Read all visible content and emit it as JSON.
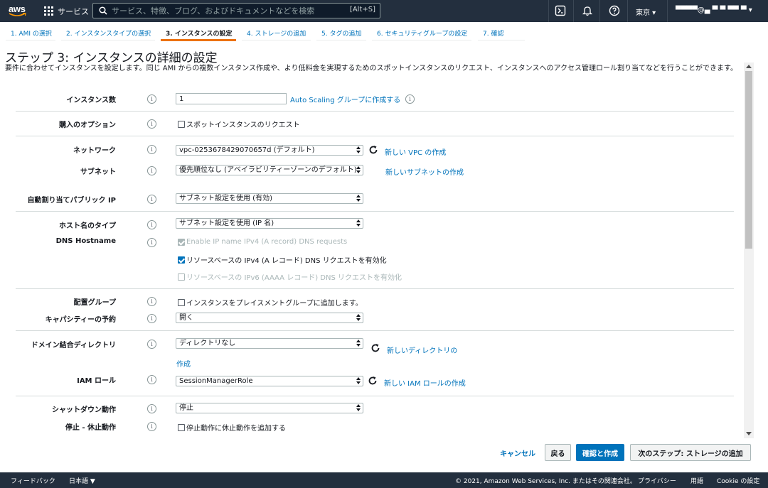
{
  "topnav": {
    "logo": "aws",
    "services": "サービス",
    "search_placeholder": "サービス、特徴、ブログ、およびドキュメントなどを検索",
    "search_shortcut": "[Alt+S]",
    "region": "東京 ▾",
    "account": "▀▀▀▀@▄ ▀ ▀ ▀▀ ▀ ▾",
    "icons": [
      "cloudshell-icon",
      "bell-icon",
      "help-icon"
    ]
  },
  "steps": [
    {
      "label": "1. AMI の選択",
      "active": false
    },
    {
      "label": "2. インスタンスタイプの選択",
      "active": false
    },
    {
      "label": "3. インスタンスの設定",
      "active": true
    },
    {
      "label": "4. ストレージの追加",
      "active": false
    },
    {
      "label": "5. タグの追加",
      "active": false
    },
    {
      "label": "6. セキュリティグループの設定",
      "active": false
    },
    {
      "label": "7. 確認",
      "active": false
    }
  ],
  "page": {
    "title": "ステップ 3: インスタンスの詳細の設定",
    "description": "要件に合わせてインスタンスを設定します。同じ AMI からの複数インスタンス作成や、より低料金を実現するためのスポットインスタンスのリクエスト、インスタンスへのアクセス管理ロール割り当てなどを行うことができます。"
  },
  "form": {
    "instance_count": {
      "label": "インスタンス数",
      "value": "1",
      "link": "Auto Scaling グループに作成する"
    },
    "purchase_option": {
      "label": "購入のオプション",
      "checkbox": "スポットインスタンスのリクエスト"
    },
    "network": {
      "label": "ネットワーク",
      "value": "vpc-0253678429070657d (デフォルト)",
      "link": "新しい VPC の作成"
    },
    "subnet": {
      "label": "サブネット",
      "value": "優先順位なし (アベイラビリティーゾーンのデフォルト)",
      "link": "新しいサブネットの作成"
    },
    "auto_public_ip": {
      "label": "自動割り当てパブリック IP",
      "value": "サブネット設定を使用 (有効)"
    },
    "hostname_type": {
      "label": "ホスト名のタイプ",
      "value": "サブネット設定を使用 (IP 名)"
    },
    "dns_hostname": {
      "label": "DNS Hostname",
      "opt1": "Enable IP name IPv4 (A record) DNS requests",
      "opt2": "リソースベースの IPv4 (A レコード) DNS リクエストを有効化",
      "opt3": "リソースベースの IPv6 (AAAA レコード) DNS リクエストを有効化"
    },
    "placement_group": {
      "label": "配置グループ",
      "checkbox": "インスタンスをプレイスメントグループに追加します。"
    },
    "capacity_reservation": {
      "label": "キャパシティーの予約",
      "value": "開く"
    },
    "domain_directory": {
      "label": "ドメイン結合ディレクトリ",
      "value": "ディレクトリなし",
      "link1": "新しいディレクトリの",
      "link2": "作成"
    },
    "iam_role": {
      "label": "IAM ロール",
      "value": "SessionManagerRole",
      "link": "新しい IAM ロールの作成"
    },
    "shutdown_behavior": {
      "label": "シャットダウン動作",
      "value": "停止"
    },
    "stop_hibernate": {
      "label": "停止 - 休止動作",
      "checkbox": "停止動作に休止動作を追加する"
    }
  },
  "actions": {
    "cancel": "キャンセル",
    "back": "戻る",
    "review_launch": "確認と作成",
    "next": "次のステップ: ストレージの追加"
  },
  "footer": {
    "feedback": "フィードバック",
    "language": "日本語 ▼",
    "copyright": "© 2021, Amazon Web Services, Inc. またはその関連会社。",
    "privacy": "プライバシー",
    "terms": "用語",
    "cookie": "Cookie の設定"
  },
  "colors": {
    "nav_bg": "#232f3e",
    "link": "#0073bb",
    "active_tab": "#ec7211",
    "primary_button": "#0073bb"
  }
}
